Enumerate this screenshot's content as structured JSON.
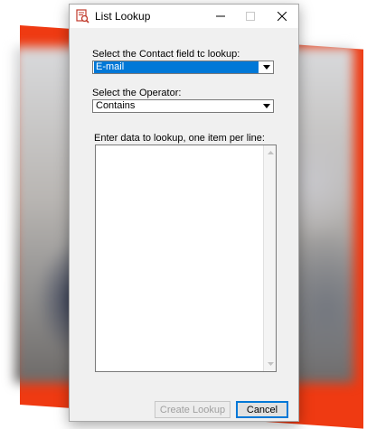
{
  "window": {
    "title": "List Lookup",
    "icon": "list-lookup-icon"
  },
  "titlebar_buttons": {
    "minimize_icon": "minimize-icon",
    "maximize_icon": "maximize-icon",
    "close_icon": "close-icon"
  },
  "contact_field": {
    "label": "Select the Contact field tc lookup:",
    "value": "E-mail"
  },
  "operator": {
    "label": "Select the Operator:",
    "value": "Contains"
  },
  "lookup_data": {
    "label": "Enter data to lookup, one item per line:",
    "value": ""
  },
  "buttons": {
    "create_label": "Create Lookup",
    "cancel_label": "Cancel"
  },
  "colors": {
    "accent": "#0078d7",
    "background_accent": "#ef3a12"
  }
}
